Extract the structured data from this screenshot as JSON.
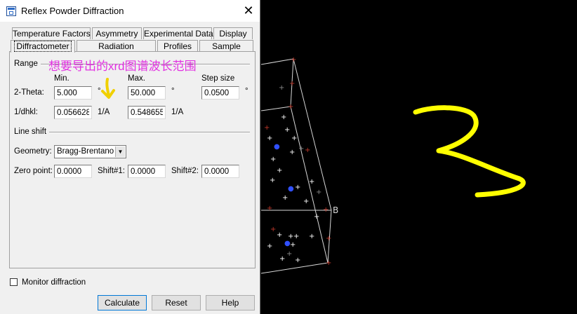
{
  "window": {
    "title": "Reflex Powder Diffraction"
  },
  "tabs": {
    "row1": [
      "Temperature Factors",
      "Asymmetry",
      "Experimental Data",
      "Display"
    ],
    "row2": [
      "Diffractometer",
      "Radiation",
      "Profiles",
      "Sample"
    ],
    "selected": "Diffractometer"
  },
  "range": {
    "label": "Range",
    "min_header": "Min.",
    "max_header": "Max.",
    "step_header": "Step size",
    "two_theta_label": "2-Theta:",
    "two_theta_min": "5.000",
    "two_theta_max": "50.000",
    "step_size": "0.0500",
    "degree_unit": "°",
    "dhkl_label": "1/dhkl:",
    "dhkl_min": "0.056628",
    "dhkl_max": "0.548655",
    "dhkl_unit": "1/A"
  },
  "line_shift": {
    "label": "Line shift",
    "geometry_label": "Geometry:",
    "geometry_value": "Bragg-Brentano",
    "zero_point_label": "Zero point:",
    "zero_point_value": "0.0000",
    "shift1_label": "Shift#1:",
    "shift1_value": "0.0000",
    "shift2_label": "Shift#2:",
    "shift2_value": "0.0000"
  },
  "monitor": {
    "label": "Monitor diffraction",
    "checked": false
  },
  "buttons": {
    "calculate": "Calculate",
    "reset": "Reset",
    "help": "Help"
  },
  "annotation": {
    "text": "想要导出的xrd图谱波长范围",
    "color": "#e232e2"
  },
  "viewer": {
    "corner_label": "B"
  },
  "colors": {
    "handwriting": "#ffff00",
    "annotation_arrow": "#f0d000"
  }
}
